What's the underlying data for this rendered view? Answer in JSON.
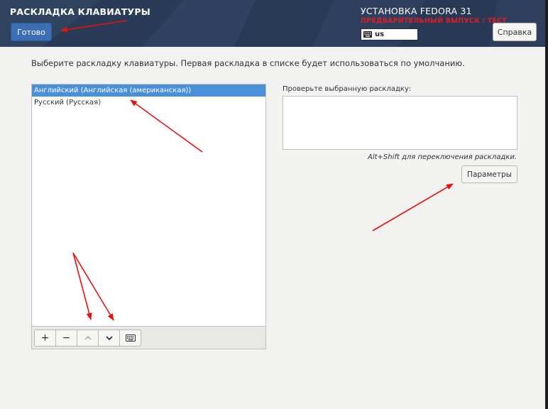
{
  "header": {
    "spoke_title": "РАСКЛАДКА КЛАВИАТУРЫ",
    "done_label": "Готово",
    "product_title": "УСТАНОВКА FEDORA 31",
    "prerelease_warning": "ПРЕДВАРИТЕЛЬНЫЙ ВЫПУСК / ТЕСТ",
    "keyboard_layout": "us",
    "help_label": "Справка"
  },
  "main": {
    "instructions": "Выберите раскладку клавиатуры. Первая раскладка в списке будет использоваться по умолчанию.",
    "layouts": [
      {
        "label": "Английский (Английская (американская))",
        "selected": true
      },
      {
        "label": "Русский (Русская)",
        "selected": false
      }
    ],
    "toolbar": {
      "add": "+",
      "remove": "−",
      "up": "⌃",
      "down": "⌄"
    },
    "test_label": "Проверьте выбранную раскладку:",
    "switch_hint": "Alt+Shift для переключения раскладки.",
    "options_label": "Параметры"
  },
  "colors": {
    "header_bg": "#2c3e5c",
    "accent": "#3c6eb4",
    "selection": "#4a90d9",
    "warning": "#e01b24",
    "annotation_arrows": "#e8110f"
  }
}
